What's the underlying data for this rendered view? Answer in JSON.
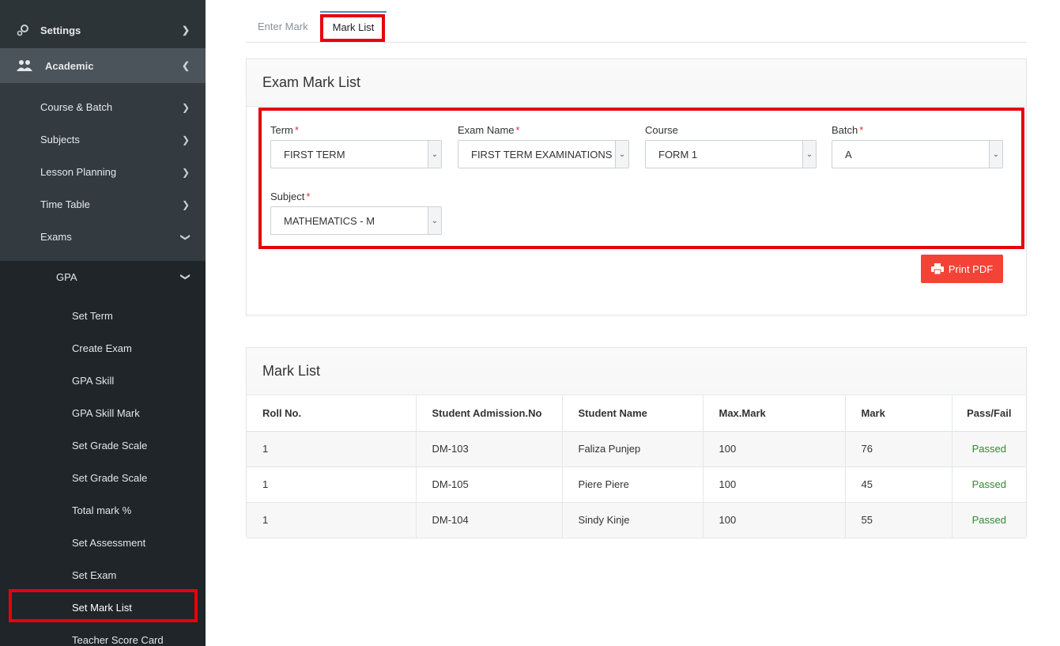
{
  "sidebar": {
    "settings": "Settings",
    "academic": "Academic",
    "sub_items": [
      "Course & Batch",
      "Subjects",
      "Lesson Planning",
      "Time Table",
      "Exams"
    ],
    "gpa": "GPA",
    "gpa_items": [
      "Set Term",
      "Create Exam",
      "GPA Skill",
      "GPA Skill Mark",
      "Set Grade Scale",
      "Set Grade Scale",
      "Total mark %",
      "Set Assessment",
      "Set Exam",
      "Set Mark List",
      "Teacher Score Card"
    ],
    "active_item": "Set Mark List"
  },
  "tabs": [
    "Enter Mark",
    "Mark List"
  ],
  "filter_panel": {
    "title": "Exam Mark List",
    "fields": {
      "term": {
        "label": "Term",
        "value": "FIRST TERM"
      },
      "exam_name": {
        "label": "Exam Name",
        "value": "FIRST TERM EXAMINATIONS"
      },
      "course": {
        "label": "Course",
        "value": "FORM 1"
      },
      "batch": {
        "label": "Batch",
        "value": "A"
      },
      "subject": {
        "label": "Subject",
        "value": "MATHEMATICS - M"
      }
    },
    "required_mark": "*",
    "print_button": "Print PDF"
  },
  "mark_list": {
    "title": "Mark List",
    "columns": [
      "Roll No.",
      "Student Admission.No",
      "Student Name",
      "Max.Mark",
      "Mark",
      "Pass/Fail"
    ],
    "rows": [
      [
        "1",
        "DM-103",
        "Faliza Punjep",
        "100",
        "76",
        "Passed"
      ],
      [
        "1",
        "DM-105",
        "Piere Piere",
        "100",
        "45",
        "Passed"
      ],
      [
        "1",
        "DM-104",
        "Sindy Kinje",
        "100",
        "55",
        "Passed"
      ]
    ]
  },
  "colors": {
    "sidebar_bg": "#2d3438",
    "highlight": "#e8000b",
    "print_button": "#f44336",
    "passed": "#2e8b2e",
    "tab_accent": "#3f8fd6"
  }
}
